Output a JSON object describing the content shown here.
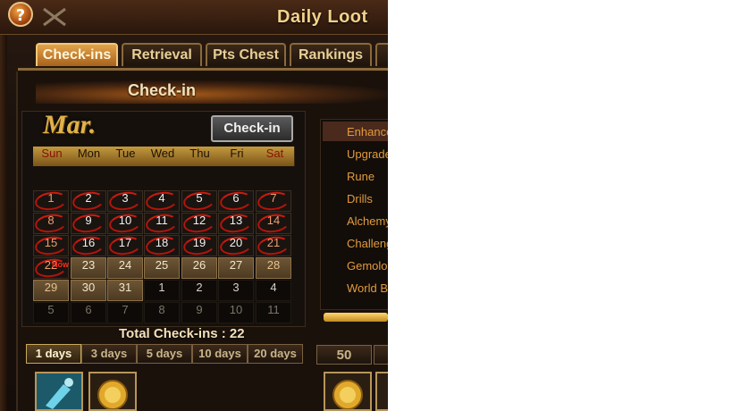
{
  "window": {
    "title": "Daily Loot",
    "help_label": "?"
  },
  "tabs": [
    {
      "label": "Check-ins",
      "active": true
    },
    {
      "label": "Retrieval",
      "active": false
    },
    {
      "label": "Pts Chest",
      "active": false
    },
    {
      "label": "Rankings",
      "active": false
    }
  ],
  "section": {
    "title": "Check-in"
  },
  "calendar": {
    "month": "Mar.",
    "checkin_button": "Check-in",
    "weekdays": [
      "Sun",
      "Mon",
      "Tue",
      "Wed",
      "Thu",
      "Fri",
      "Sat"
    ],
    "now_label": "Now",
    "weeks": [
      [
        "1",
        "2",
        "3",
        "4",
        "5",
        "6",
        "7"
      ],
      [
        "8",
        "9",
        "10",
        "11",
        "12",
        "13",
        "14"
      ],
      [
        "15",
        "16",
        "17",
        "18",
        "19",
        "20",
        "21"
      ],
      [
        "22",
        "23",
        "24",
        "25",
        "26",
        "27",
        "28"
      ],
      [
        "29",
        "30",
        "31",
        "1",
        "2",
        "3",
        "4"
      ],
      [
        "5",
        "6",
        "7",
        "8",
        "9",
        "10",
        "11"
      ]
    ],
    "total_label": "Total Check-ins",
    "total_sep": ":",
    "total_value": "22"
  },
  "reward_tabs": [
    "1 days",
    "3 days",
    "5 days",
    "10 days",
    "20 days"
  ],
  "side_list": [
    "Enhance",
    "Upgrade",
    "Rune",
    "Drills",
    "Alchemy",
    "Challeng",
    "Gemolog",
    "World BO"
  ],
  "points_tab": "50",
  "colors": {
    "accent": "#e2a24a",
    "checked_ring": "#b3150b",
    "list_text": "#e29a3c"
  }
}
